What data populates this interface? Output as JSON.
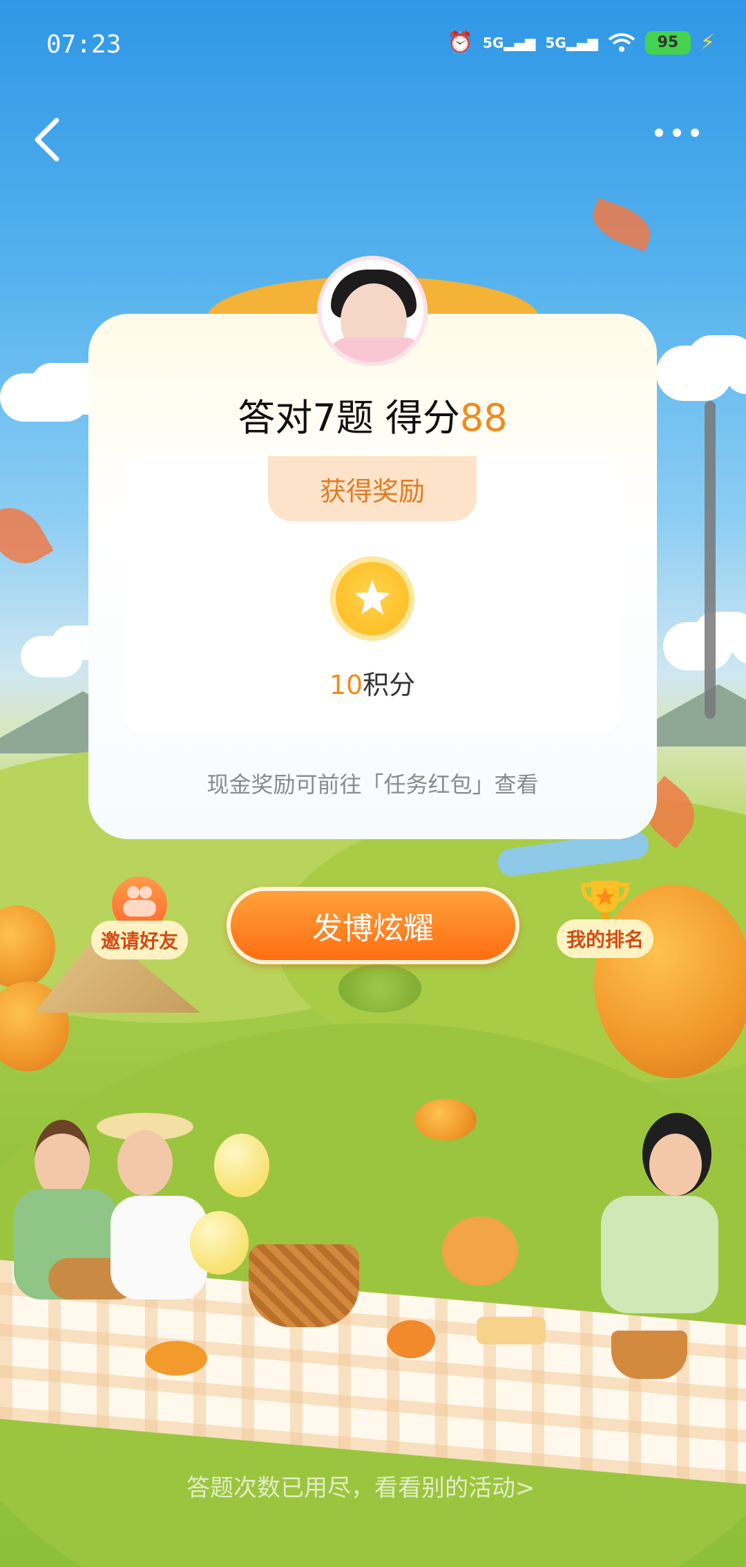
{
  "status_bar": {
    "time": "07:23",
    "battery": "95",
    "signal_1": "5G",
    "signal_2": "5G"
  },
  "nav": {
    "back_icon": "chevron-left-icon",
    "more_icon": "more-dots-icon"
  },
  "result": {
    "prefix": "答对7题 得分",
    "score": "88"
  },
  "reward": {
    "tag": "获得奖励",
    "coin_icon": "star-coin-icon",
    "points_value": "10",
    "points_unit": "积分",
    "note": "现金奖励可前往「任务红包」查看"
  },
  "actions": {
    "invite_label": "邀请好友",
    "share_label": "发博炫耀",
    "rank_label": "我的排名"
  },
  "footer": {
    "text": "答题次数已用尽，看看别的活动>"
  },
  "colors": {
    "accent_orange": "#ef8b1b",
    "button_orange": "#ff7a17",
    "tag_bg": "#fde3c9"
  }
}
